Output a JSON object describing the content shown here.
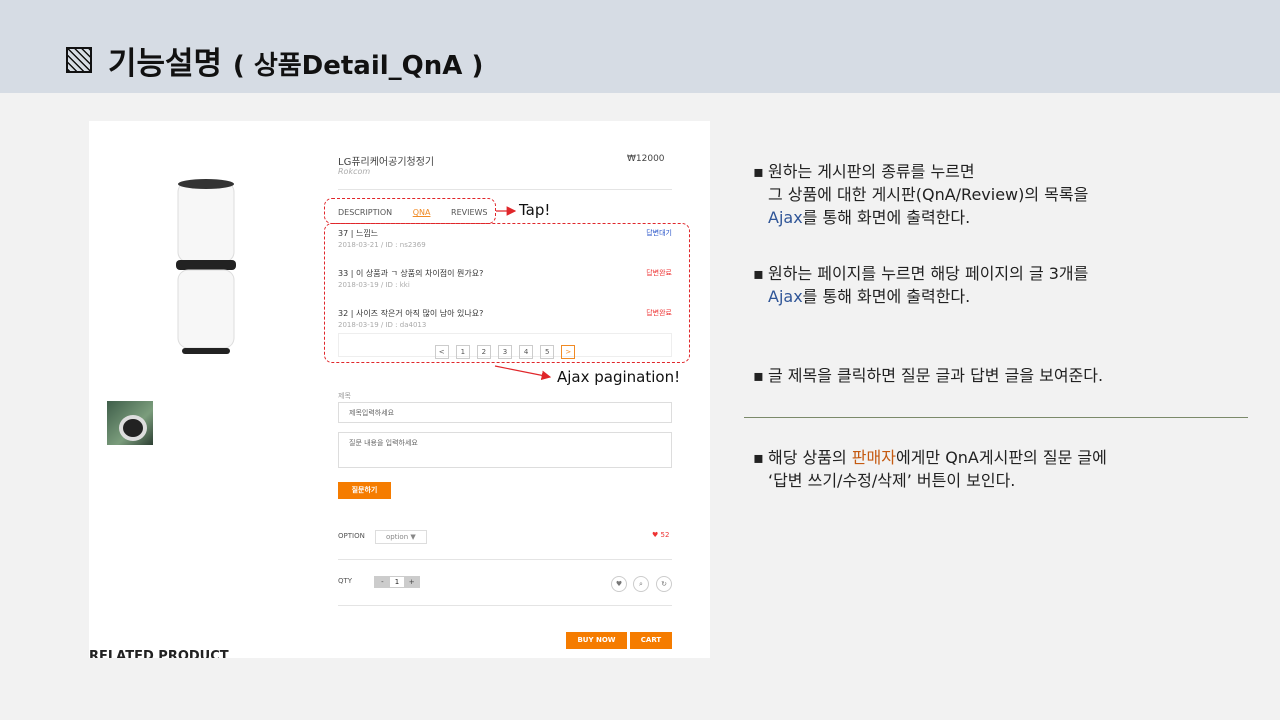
{
  "slide": {
    "title": "기능설명",
    "subtitle": "( 상품Detail_QnA )"
  },
  "product": {
    "name": "LG퓨리케어공기청정기",
    "brand": "Rokcom",
    "price": "₩12000"
  },
  "tabs": [
    "DESCRIPTION",
    "QNA",
    "REVIEWS"
  ],
  "qna": [
    {
      "title": "37 | 느낌느",
      "meta": "2018-03-21 / ID : ns2369",
      "status": "답변대기"
    },
    {
      "title": "33 | 이 상품과 ㄱ 상품의 차이점이 뭔가요?",
      "meta": "2018-03-19 / ID : kki",
      "status": "답변완료"
    },
    {
      "title": "32 | 사이즈 작은거 아직 많이 남아 있나요?",
      "meta": "2018-03-19 / ID : da4013",
      "status": "답변완료"
    }
  ],
  "pager": [
    "<",
    "1",
    "2",
    "3",
    "4",
    "5",
    ">"
  ],
  "form": {
    "label": "제목",
    "title_placeholder": "제목입력하세요",
    "content_placeholder": "질문 내용을 입력하세요",
    "submit": "질문하기"
  },
  "options": {
    "option_label": "OPTION",
    "option_value": "option ▼",
    "likes": "♥ 52",
    "qty_label": "QTY",
    "qty_minus": "-",
    "qty_value": "1",
    "qty_plus": "+"
  },
  "buttons": {
    "buy": "BUY NOW",
    "cart": "CART"
  },
  "related": "RELATED PRODUCT",
  "annotations": {
    "tap": "Tap!",
    "ajax": "Ajax pagination!"
  },
  "bullets": {
    "b1": {
      "l1": "원하는 게시판의 종류를 누르면",
      "l2": "그 상품에 대한 게시판(QnA/Review)의 목록을",
      "l3a": "Ajax",
      "l3b": "를 통해 화면에 출력한다."
    },
    "b2": {
      "l1": "원하는 페이지를 누르면 해당 페이지의 글 3개를",
      "l2a": "Ajax",
      "l2b": "를 통해 화면에 출력한다."
    },
    "b3": {
      "l1": "글 제목을 클릭하면 질문 글과 답변 글을 보여준다."
    },
    "b4": {
      "l1a": "해당 상품의 ",
      "l1b": "판매자",
      "l1c": "에게만 QnA게시판의 질문 글에",
      "l2": "‘답변 쓰기/수정/삭제’ 버튼이 보인다."
    }
  },
  "colors": {
    "accent": "#f57c00",
    "header_bg": "#d6dce4",
    "annotation": "#e0262a",
    "ajax": "#2f5597"
  }
}
